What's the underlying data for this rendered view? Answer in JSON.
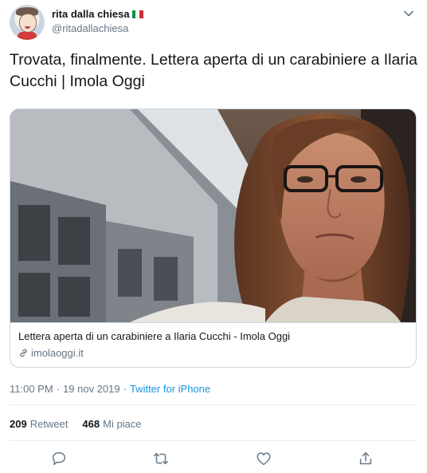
{
  "user": {
    "display_name": "rita dalla chiesa",
    "handle": "@ritadallachiesa",
    "flag_colors": [
      "#009246",
      "#ffffff",
      "#ce2b37"
    ]
  },
  "tweet": {
    "text": "Trovata, finalmente. Lettera aperta di un carabiniere a Ilaria Cucchi | Imola Oggi"
  },
  "card": {
    "title": "Lettera aperta di un carabiniere a Ilaria Cucchi - Imola Oggi",
    "domain": "imolaoggi.it"
  },
  "meta": {
    "time": "11:00 PM",
    "separator": "·",
    "date": "19 nov 2019",
    "source": "Twitter for iPhone"
  },
  "stats": {
    "retweets_count": "209",
    "retweets_label": "Retweet",
    "likes_count": "468",
    "likes_label": "Mi piace"
  },
  "icons": {
    "caret": "chevron-down-icon",
    "reply": "reply-icon",
    "retweet": "retweet-icon",
    "like": "heart-icon",
    "share": "share-icon",
    "link": "link-icon"
  },
  "colors": {
    "text": "#14171a",
    "secondary": "#657786",
    "link": "#1b95e0",
    "border": "#ccd6dd"
  }
}
